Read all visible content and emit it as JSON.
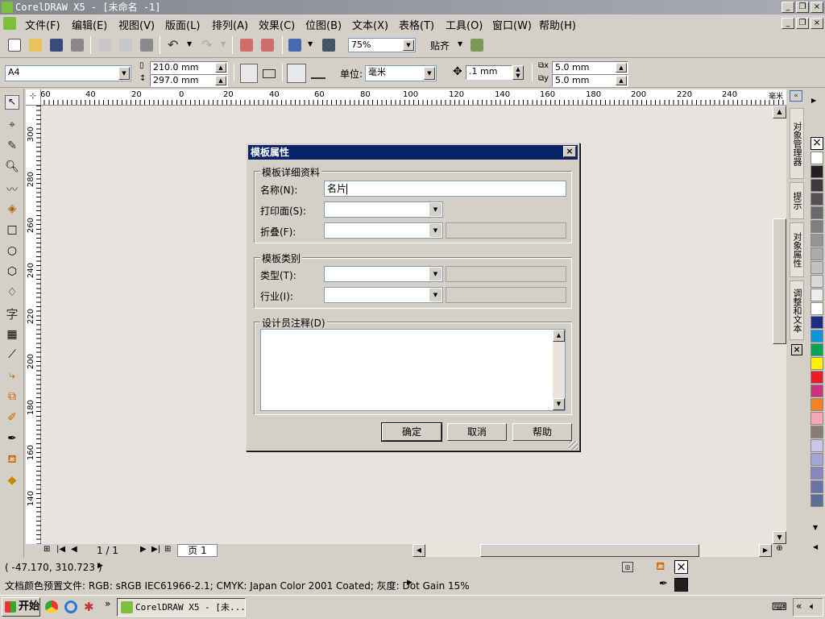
{
  "window": {
    "title": "CorelDRAW X5 - [未命名 -1]"
  },
  "menu": [
    "文件(F)",
    "编辑(E)",
    "视图(V)",
    "版面(L)",
    "排列(A)",
    "效果(C)",
    "位图(B)",
    "文本(X)",
    "表格(T)",
    "工具(O)",
    "窗口(W)",
    "帮助(H)"
  ],
  "toolbar": {
    "zoom": "75%",
    "snap_label": "贴齐"
  },
  "propbar": {
    "page_size": "A4",
    "width": "210.0 mm",
    "height": "297.0 mm",
    "units_label": "单位:",
    "units_value": "毫米",
    "nudge": ".1 mm",
    "dup_x": "5.0 mm",
    "dup_y": "5.0 mm"
  },
  "ruler": {
    "h_ticks": [
      "60",
      "40",
      "20",
      "0",
      "20",
      "40",
      "60",
      "80",
      "100",
      "120",
      "140",
      "160",
      "180",
      "200",
      "220",
      "240",
      "毫米"
    ],
    "v_ticks": [
      "300",
      "280",
      "260",
      "240",
      "220",
      "200",
      "180",
      "160",
      "140"
    ]
  },
  "page_nav": {
    "page_counter": "1 / 1",
    "page_tab": "页 1"
  },
  "dockers": [
    "对象管理器",
    "提示",
    "对象属性",
    "调整和文本"
  ],
  "palette_colors": [
    "#ffffff",
    "#231f20",
    "#3d3b3c",
    "#545254",
    "#696869",
    "#7f7e80",
    "#959597",
    "#abaaad",
    "#c1c1c3",
    "#d7d7d9",
    "#ececef",
    "#ffffff",
    "#1b2e86",
    "#0e96dd",
    "#00a650",
    "#fff100",
    "#ed1c24",
    "#c9327c",
    "#f58220",
    "#f7a8b8",
    "#8c7b72",
    "#c8c7e4",
    "#a3a6d4",
    "#8886c3",
    "#6c73a8",
    "#5b6d9a"
  ],
  "dialog": {
    "title": "模板属性",
    "details_group": "模板详细资料",
    "name_label": "名称(N):",
    "name_value": "名片",
    "print_label": "打印面(S):",
    "fold_label": "折叠(F):",
    "category_group": "模板类别",
    "type_label": "类型(T):",
    "industry_label": "行业(I):",
    "notes_label": "设计员注释(D)",
    "ok": "确定",
    "cancel": "取消",
    "help": "帮助"
  },
  "status": {
    "coords": "( -47.170, 310.723 )",
    "color_profile": "文档颜色预置文件: RGB: sRGB IEC61966-2.1; CMYK: Japan Color 2001 Coated; 灰度: Dot Gain 15%"
  },
  "taskbar": {
    "start": "开始",
    "task": "CorelDRAW X5 - [未..."
  }
}
